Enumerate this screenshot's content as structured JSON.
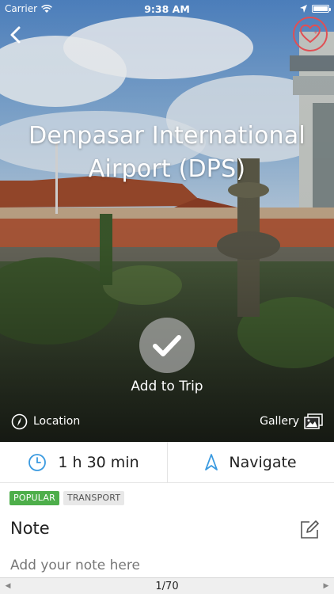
{
  "status_bar": {
    "carrier": "Carrier",
    "time": "9:38 AM"
  },
  "place": {
    "title_line1": "Denpasar International",
    "title_line2": "Airport (DPS)"
  },
  "actions": {
    "add_to_trip": "Add to Trip",
    "location": "Location",
    "gallery": "Gallery"
  },
  "info": {
    "duration": "1 h 30 min",
    "navigate": "Navigate"
  },
  "tags": [
    "POPULAR",
    "TRANSPORT"
  ],
  "note": {
    "heading": "Note",
    "placeholder": "Add your note here"
  },
  "pager": {
    "text": "1/70"
  },
  "colors": {
    "favorite": "#e04f54",
    "popular_tag": "#4dae4a",
    "navigate_accent": "#3a9ae0",
    "duration_icon": "#3a9ae0"
  },
  "icons": [
    "back-chevron-icon",
    "heart-icon",
    "checkmark-icon",
    "compass-icon",
    "gallery-icon",
    "clock-icon",
    "navigation-arrow-icon",
    "edit-icon"
  ]
}
